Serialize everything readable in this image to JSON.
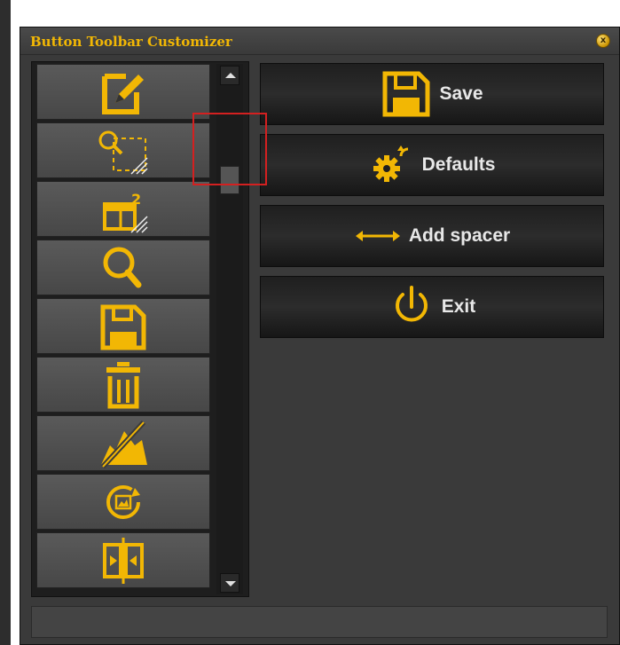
{
  "window": {
    "title": "Button Toolbar Customizer",
    "close_icon_glyph": "x",
    "accent_color": "#f2b704"
  },
  "toolbar_buttons": [
    {
      "icon": "edit-icon"
    },
    {
      "icon": "zoom-selection-icon"
    },
    {
      "icon": "layout-2-icon"
    },
    {
      "icon": "search-icon"
    },
    {
      "icon": "save-icon"
    },
    {
      "icon": "trash-icon"
    },
    {
      "icon": "image-crop-icon"
    },
    {
      "icon": "rotate-image-icon"
    },
    {
      "icon": "flip-horizontal-icon"
    }
  ],
  "actions": {
    "save_label": "Save",
    "defaults_label": "Defaults",
    "add_spacer_label": "Add spacer",
    "exit_label": "Exit"
  }
}
